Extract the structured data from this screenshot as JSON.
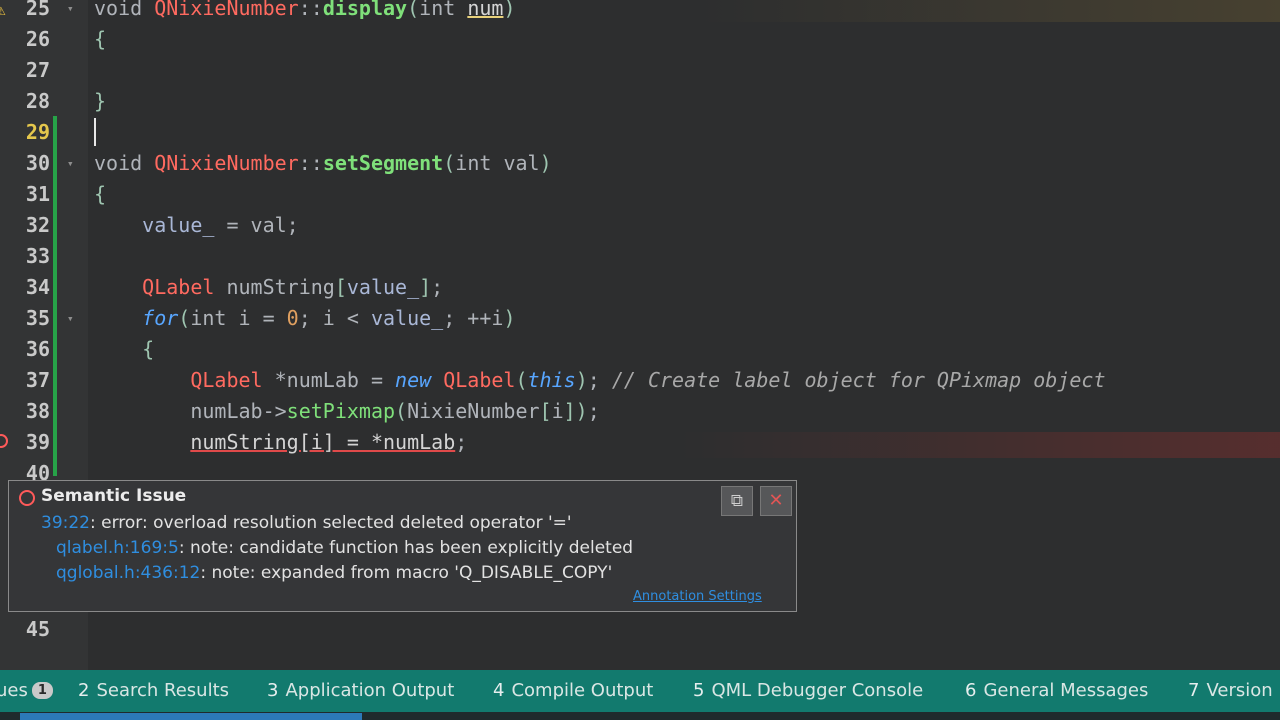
{
  "editor": {
    "lines": [
      {
        "n": "25",
        "fold": true,
        "html": [
          [
            "kw",
            "void "
          ],
          [
            "cls",
            "QNixieNumber"
          ],
          [
            "kw",
            "::"
          ],
          [
            "fn",
            "display"
          ],
          [
            "par",
            "("
          ],
          [
            "kw",
            "int "
          ],
          [
            "und",
            "num"
          ],
          [
            "par",
            ")"
          ]
        ]
      },
      {
        "n": "26",
        "fold": false,
        "html": [
          [
            "par",
            "{"
          ]
        ]
      },
      {
        "n": "27",
        "fold": false,
        "html": []
      },
      {
        "n": "28",
        "fold": false,
        "html": [
          [
            "par",
            "}"
          ]
        ]
      },
      {
        "n": "29",
        "fold": false,
        "html": [],
        "current": true
      },
      {
        "n": "30",
        "fold": true,
        "html": [
          [
            "kw",
            "void "
          ],
          [
            "cls",
            "QNixieNumber"
          ],
          [
            "kw",
            "::"
          ],
          [
            "fn",
            "setSegment"
          ],
          [
            "par",
            "("
          ],
          [
            "kw",
            "int val"
          ],
          [
            "par",
            ")"
          ]
        ]
      },
      {
        "n": "31",
        "fold": false,
        "html": [
          [
            "par",
            "{"
          ]
        ]
      },
      {
        "n": "32",
        "fold": false,
        "html": [
          [
            "var",
            "    value_ "
          ],
          [
            "kw",
            "= val;"
          ]
        ]
      },
      {
        "n": "33",
        "fold": false,
        "html": []
      },
      {
        "n": "34",
        "fold": false,
        "html": [
          [
            "cls",
            "    QLabel "
          ],
          [
            "kw",
            "numString"
          ],
          [
            "par",
            "["
          ],
          [
            "var",
            "value_"
          ],
          [
            "par",
            "]"
          ],
          [
            "kw",
            ";"
          ]
        ]
      },
      {
        "n": "35",
        "fold": true,
        "html": [
          [
            "kwi",
            "    for"
          ],
          [
            "par",
            "("
          ],
          [
            "kw",
            "int i = "
          ],
          [
            "num",
            "0"
          ],
          [
            "kw",
            "; i < "
          ],
          [
            "var",
            "value_"
          ],
          [
            "kw",
            "; ++i"
          ],
          [
            "par",
            ")"
          ]
        ]
      },
      {
        "n": "36",
        "fold": false,
        "html": [
          [
            "par",
            "    {"
          ]
        ]
      },
      {
        "n": "37",
        "fold": false,
        "html": [
          [
            "cls",
            "        QLabel "
          ],
          [
            "kw",
            "*numLab = "
          ],
          [
            "kwi",
            "new "
          ],
          [
            "cls",
            "QLabel"
          ],
          [
            "par",
            "("
          ],
          [
            "kwi",
            "this"
          ],
          [
            "par",
            ")"
          ],
          [
            "kw",
            "; "
          ],
          [
            "cmt",
            "// Create label object for QPixmap object"
          ]
        ]
      },
      {
        "n": "38",
        "fold": false,
        "html": [
          [
            "kw",
            "        numLab->"
          ],
          [
            "fn2",
            "setPixmap"
          ],
          [
            "par",
            "("
          ],
          [
            "kw",
            "NixieNumber"
          ],
          [
            "par",
            "["
          ],
          [
            "kw",
            "i"
          ],
          [
            "par",
            "]"
          ],
          [
            "par",
            ")"
          ],
          [
            "kw",
            ";"
          ]
        ]
      },
      {
        "n": "39",
        "fold": false,
        "html": [
          [
            "kw",
            "        "
          ],
          [
            "err",
            "numString[i] = *numLab"
          ],
          [
            "kw",
            ";"
          ]
        ]
      },
      {
        "n": "40",
        "fold": false,
        "html": []
      },
      {
        "n": "45",
        "fold": false,
        "html": []
      }
    ]
  },
  "tooltip": {
    "title": "Semantic Issue",
    "lines": [
      {
        "link": "39:22",
        "text": ": error: overload resolution selected deleted operator '='"
      },
      {
        "link": "qlabel.h:169:5",
        "text": ": note: candidate function has been explicitly deleted"
      },
      {
        "link": "qglobal.h:436:12",
        "text": ": note: expanded from macro 'Q_DISABLE_COPY'"
      }
    ],
    "settings_link": "Annotation Settings"
  },
  "statusbar": {
    "panes": [
      {
        "num": "",
        "label": "ues",
        "badge": "1"
      },
      {
        "num": "2",
        "label": "Search Results"
      },
      {
        "num": "3",
        "label": "Application Output"
      },
      {
        "num": "4",
        "label": "Compile Output"
      },
      {
        "num": "5",
        "label": "QML Debugger Console"
      },
      {
        "num": "6",
        "label": "General Messages"
      },
      {
        "num": "7",
        "label": "Version"
      }
    ]
  },
  "colors": {
    "accent": "#127a6e",
    "error": "#ff5a5a",
    "warning": "#f3c640",
    "link": "#2f8ee0"
  }
}
